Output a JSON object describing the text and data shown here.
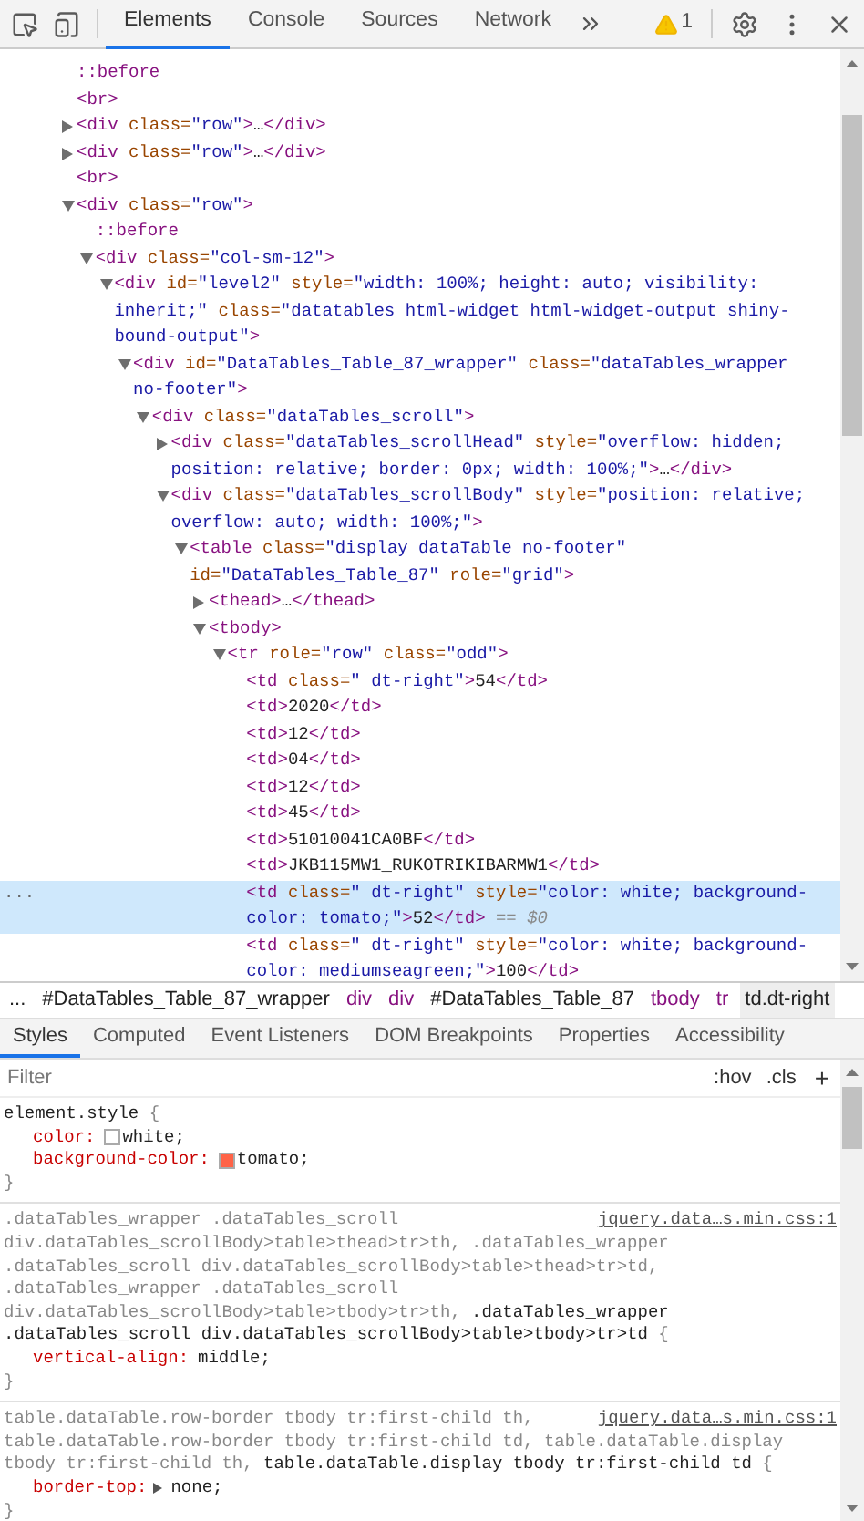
{
  "toolbar": {
    "tabs": [
      {
        "label": "Elements",
        "selected": true
      },
      {
        "label": "Console",
        "selected": false
      },
      {
        "label": "Sources",
        "selected": false
      },
      {
        "label": "Network",
        "selected": false
      }
    ],
    "warnings_count": "1"
  },
  "dom_tree": [
    {
      "kind": "leaf",
      "selected": false,
      "tokens": [
        {
          "kind": "pseudo",
          "text": "::before"
        }
      ]
    },
    {
      "kind": "leaf",
      "selected": false,
      "tokens": [
        {
          "kind": "tag",
          "text": "<br>"
        }
      ]
    },
    {
      "kind": "collapsed",
      "selected": false,
      "tokens": [
        {
          "kind": "tag",
          "text": "<div"
        },
        {
          "kind": "attr",
          "text": " class="
        },
        {
          "kind": "value",
          "text": "\"row\""
        },
        {
          "kind": "tag",
          "text": ">"
        },
        {
          "kind": "text",
          "text": "…"
        },
        {
          "kind": "tag",
          "text": "</div>"
        }
      ]
    },
    {
      "kind": "collapsed",
      "selected": false,
      "tokens": [
        {
          "kind": "tag",
          "text": "<div"
        },
        {
          "kind": "attr",
          "text": " class="
        },
        {
          "kind": "value",
          "text": "\"row\""
        },
        {
          "kind": "tag",
          "text": ">"
        },
        {
          "kind": "text",
          "text": "…"
        },
        {
          "kind": "tag",
          "text": "</div>"
        }
      ]
    },
    {
      "kind": "leaf",
      "selected": false,
      "tokens": [
        {
          "kind": "tag",
          "text": "<br>"
        }
      ]
    },
    {
      "kind": "expanded",
      "selected": false,
      "tokens": [
        {
          "kind": "tag",
          "text": "<div"
        },
        {
          "kind": "attr",
          "text": " class="
        },
        {
          "kind": "value",
          "text": "\"row\""
        },
        {
          "kind": "tag",
          "text": ">"
        }
      ],
      "children": [
        {
          "kind": "leaf",
          "selected": false,
          "tokens": [
            {
              "kind": "pseudo",
              "text": "::before"
            }
          ]
        },
        {
          "kind": "expanded",
          "selected": false,
          "tokens": [
            {
              "kind": "tag",
              "text": "<div"
            },
            {
              "kind": "attr",
              "text": " class="
            },
            {
              "kind": "value",
              "text": "\"col-sm-12\""
            },
            {
              "kind": "tag",
              "text": ">"
            }
          ],
          "children": [
            {
              "kind": "expanded",
              "selected": false,
              "tokens": [
                {
                  "kind": "tag",
                  "text": "<div"
                },
                {
                  "kind": "attr",
                  "text": " id="
                },
                {
                  "kind": "value",
                  "text": "\"level2\""
                },
                {
                  "kind": "attr",
                  "text": " style="
                },
                {
                  "kind": "value",
                  "text": "\"width: 100%; height: auto; visibility: inherit;\""
                },
                {
                  "kind": "attr",
                  "text": " class="
                },
                {
                  "kind": "value",
                  "text": "\"datatables html-widget html-widget-output shiny-bound-output\""
                },
                {
                  "kind": "tag",
                  "text": ">"
                }
              ],
              "children": [
                {
                  "kind": "expanded",
                  "selected": false,
                  "tokens": [
                    {
                      "kind": "tag",
                      "text": "<div"
                    },
                    {
                      "kind": "attr",
                      "text": " id="
                    },
                    {
                      "kind": "value",
                      "text": "\"DataTables_Table_87_wrapper\""
                    },
                    {
                      "kind": "attr",
                      "text": " class="
                    },
                    {
                      "kind": "value",
                      "text": "\"dataTables_wrapper no-footer\""
                    },
                    {
                      "kind": "tag",
                      "text": ">"
                    }
                  ],
                  "children": [
                    {
                      "kind": "expanded",
                      "selected": false,
                      "tokens": [
                        {
                          "kind": "tag",
                          "text": "<div"
                        },
                        {
                          "kind": "attr",
                          "text": " class="
                        },
                        {
                          "kind": "value",
                          "text": "\"dataTables_scroll\""
                        },
                        {
                          "kind": "tag",
                          "text": ">"
                        }
                      ],
                      "children": [
                        {
                          "kind": "collapsed",
                          "selected": false,
                          "tokens": [
                            {
                              "kind": "tag",
                              "text": "<div"
                            },
                            {
                              "kind": "attr",
                              "text": " class="
                            },
                            {
                              "kind": "value",
                              "text": "\"dataTables_scrollHead\""
                            },
                            {
                              "kind": "attr",
                              "text": " style="
                            },
                            {
                              "kind": "value",
                              "text": "\"overflow: hidden; position: relative; border: 0px; width: 100%;\""
                            },
                            {
                              "kind": "tag",
                              "text": ">"
                            },
                            {
                              "kind": "text",
                              "text": "…"
                            },
                            {
                              "kind": "tag",
                              "text": "</div>"
                            }
                          ]
                        },
                        {
                          "kind": "expanded",
                          "selected": false,
                          "tokens": [
                            {
                              "kind": "tag",
                              "text": "<div"
                            },
                            {
                              "kind": "attr",
                              "text": " class="
                            },
                            {
                              "kind": "value",
                              "text": "\"dataTables_scrollBody\""
                            },
                            {
                              "kind": "attr",
                              "text": " style="
                            },
                            {
                              "kind": "value",
                              "text": "\"position: relative; overflow: auto; width: 100%;\""
                            },
                            {
                              "kind": "tag",
                              "text": ">"
                            }
                          ],
                          "children": [
                            {
                              "kind": "expanded",
                              "selected": false,
                              "tokens": [
                                {
                                  "kind": "tag",
                                  "text": "<table"
                                },
                                {
                                  "kind": "attr",
                                  "text": " class="
                                },
                                {
                                  "kind": "value",
                                  "text": "\"display dataTable no-footer\""
                                },
                                {
                                  "kind": "attr",
                                  "text": " id="
                                },
                                {
                                  "kind": "value",
                                  "text": "\"DataTables_Table_87\""
                                },
                                {
                                  "kind": "attr",
                                  "text": " role="
                                },
                                {
                                  "kind": "value",
                                  "text": "\"grid\""
                                },
                                {
                                  "kind": "tag",
                                  "text": ">"
                                }
                              ],
                              "children": [
                                {
                                  "kind": "collapsed",
                                  "selected": false,
                                  "tokens": [
                                    {
                                      "kind": "tag",
                                      "text": "<thead>"
                                    },
                                    {
                                      "kind": "text",
                                      "text": "…"
                                    },
                                    {
                                      "kind": "tag",
                                      "text": "</thead>"
                                    }
                                  ]
                                },
                                {
                                  "kind": "expanded",
                                  "selected": false,
                                  "tokens": [
                                    {
                                      "kind": "tag",
                                      "text": "<tbody>"
                                    }
                                  ],
                                  "children": [
                                    {
                                      "kind": "expanded",
                                      "selected": false,
                                      "tokens": [
                                        {
                                          "kind": "tag",
                                          "text": "<tr"
                                        },
                                        {
                                          "kind": "attr",
                                          "text": " role="
                                        },
                                        {
                                          "kind": "value",
                                          "text": "\"row\""
                                        },
                                        {
                                          "kind": "attr",
                                          "text": " class="
                                        },
                                        {
                                          "kind": "value",
                                          "text": "\"odd\""
                                        },
                                        {
                                          "kind": "tag",
                                          "text": ">"
                                        }
                                      ],
                                      "children": [
                                        {
                                          "kind": "leaf",
                                          "selected": false,
                                          "tokens": [
                                            {
                                              "kind": "tag",
                                              "text": "<td"
                                            },
                                            {
                                              "kind": "attr",
                                              "text": " class="
                                            },
                                            {
                                              "kind": "value",
                                              "text": "\" dt-right\""
                                            },
                                            {
                                              "kind": "tag",
                                              "text": ">"
                                            },
                                            {
                                              "kind": "text",
                                              "text": "54"
                                            },
                                            {
                                              "kind": "tag",
                                              "text": "</td>"
                                            }
                                          ]
                                        },
                                        {
                                          "kind": "leaf",
                                          "selected": false,
                                          "tokens": [
                                            {
                                              "kind": "tag",
                                              "text": "<td>"
                                            },
                                            {
                                              "kind": "text",
                                              "text": "2020"
                                            },
                                            {
                                              "kind": "tag",
                                              "text": "</td>"
                                            }
                                          ]
                                        },
                                        {
                                          "kind": "leaf",
                                          "selected": false,
                                          "tokens": [
                                            {
                                              "kind": "tag",
                                              "text": "<td>"
                                            },
                                            {
                                              "kind": "text",
                                              "text": "12"
                                            },
                                            {
                                              "kind": "tag",
                                              "text": "</td>"
                                            }
                                          ]
                                        },
                                        {
                                          "kind": "leaf",
                                          "selected": false,
                                          "tokens": [
                                            {
                                              "kind": "tag",
                                              "text": "<td>"
                                            },
                                            {
                                              "kind": "text",
                                              "text": "04"
                                            },
                                            {
                                              "kind": "tag",
                                              "text": "</td>"
                                            }
                                          ]
                                        },
                                        {
                                          "kind": "leaf",
                                          "selected": false,
                                          "tokens": [
                                            {
                                              "kind": "tag",
                                              "text": "<td>"
                                            },
                                            {
                                              "kind": "text",
                                              "text": "12"
                                            },
                                            {
                                              "kind": "tag",
                                              "text": "</td>"
                                            }
                                          ]
                                        },
                                        {
                                          "kind": "leaf",
                                          "selected": false,
                                          "tokens": [
                                            {
                                              "kind": "tag",
                                              "text": "<td>"
                                            },
                                            {
                                              "kind": "text",
                                              "text": "45"
                                            },
                                            {
                                              "kind": "tag",
                                              "text": "</td>"
                                            }
                                          ]
                                        },
                                        {
                                          "kind": "leaf",
                                          "selected": false,
                                          "tokens": [
                                            {
                                              "kind": "tag",
                                              "text": "<td>"
                                            },
                                            {
                                              "kind": "text",
                                              "text": "51010041CA0BF"
                                            },
                                            {
                                              "kind": "tag",
                                              "text": "</td>"
                                            }
                                          ]
                                        },
                                        {
                                          "kind": "leaf",
                                          "selected": false,
                                          "tokens": [
                                            {
                                              "kind": "tag",
                                              "text": "<td>"
                                            },
                                            {
                                              "kind": "text",
                                              "text": "JKB115MW1_RUKOTRIKIBARMW1"
                                            },
                                            {
                                              "kind": "tag",
                                              "text": "</td>"
                                            }
                                          ]
                                        },
                                        {
                                          "kind": "leaf",
                                          "selected": true,
                                          "gutter": "...",
                                          "tokens": [
                                            {
                                              "kind": "tag",
                                              "text": "<td"
                                            },
                                            {
                                              "kind": "attr",
                                              "text": " class="
                                            },
                                            {
                                              "kind": "value",
                                              "text": "\" dt-right\""
                                            },
                                            {
                                              "kind": "attr",
                                              "text": " style="
                                            },
                                            {
                                              "kind": "value",
                                              "text": "\"color: white; background-color: tomato;\""
                                            },
                                            {
                                              "kind": "tag",
                                              "text": ">"
                                            },
                                            {
                                              "kind": "text",
                                              "text": "52"
                                            },
                                            {
                                              "kind": "tag",
                                              "text": "</td>"
                                            },
                                            {
                                              "kind": "hint",
                                              "text": " == $0"
                                            }
                                          ]
                                        },
                                        {
                                          "kind": "leaf",
                                          "selected": false,
                                          "tokens": [
                                            {
                                              "kind": "tag",
                                              "text": "<td"
                                            },
                                            {
                                              "kind": "attr",
                                              "text": " class="
                                            },
                                            {
                                              "kind": "value",
                                              "text": "\" dt-right\""
                                            },
                                            {
                                              "kind": "attr",
                                              "text": " style="
                                            },
                                            {
                                              "kind": "value",
                                              "text": "\"color: white; background-color: mediumseagreen;\""
                                            },
                                            {
                                              "kind": "tag",
                                              "text": ">"
                                            },
                                            {
                                              "kind": "text",
                                              "text": "100"
                                            },
                                            {
                                              "kind": "tag",
                                              "text": "</td>"
                                            }
                                          ]
                                        }
                                      ]
                                    }
                                  ]
                                }
                              ]
                            }
                          ]
                        }
                      ]
                    }
                  ]
                }
              ]
            }
          ]
        }
      ]
    }
  ],
  "breadcrumbs": [
    {
      "label": "...",
      "kind": "more",
      "selected": false
    },
    {
      "label": "#DataTables_Table_87_wrapper",
      "kind": "id",
      "selected": false
    },
    {
      "label": "div",
      "kind": "tag",
      "selected": false
    },
    {
      "label": "div",
      "kind": "tag",
      "selected": false
    },
    {
      "label": "#DataTables_Table_87",
      "kind": "id",
      "selected": false
    },
    {
      "label": "tbody",
      "kind": "tag",
      "selected": false
    },
    {
      "label": "tr",
      "kind": "tag",
      "selected": false
    },
    {
      "label": "td.dt-right",
      "kind": "id",
      "selected": true
    }
  ],
  "sidebar_tabs": [
    {
      "label": "Styles",
      "selected": true
    },
    {
      "label": "Computed",
      "selected": false
    },
    {
      "label": "Event Listeners",
      "selected": false
    },
    {
      "label": "DOM Breakpoints",
      "selected": false
    },
    {
      "label": "Properties",
      "selected": false
    },
    {
      "label": "Accessibility",
      "selected": false
    }
  ],
  "filter": {
    "placeholder": "Filter",
    "hov": ":hov",
    "cls": ".cls",
    "add": "+"
  },
  "rules": [
    {
      "selector_lines": [
        [
          {
            "text": "element.style",
            "matched": true
          },
          {
            "text": " {",
            "matched": false
          }
        ]
      ],
      "close": "}",
      "properties": [
        {
          "name": "color:",
          "value": "white;",
          "color": "#ffffff",
          "expandable": false
        },
        {
          "name": "background-color:",
          "value": "tomato;",
          "color": "#ff6347",
          "expandable": false
        }
      ]
    },
    {
      "source": "jquery.data…s.min.css:1",
      "selector_lines": [
        [
          {
            "text": ".dataTables_wrapper .dataTables_scroll",
            "matched": false
          }
        ],
        [
          {
            "text": "div.dataTables_scrollBody>table>thead>tr>th, .dataTables_wrapper",
            "matched": false
          }
        ],
        [
          {
            "text": ".dataTables_scroll div.dataTables_scrollBody>table>thead>tr>td,",
            "matched": false
          }
        ],
        [
          {
            "text": ".dataTables_wrapper .dataTables_scroll",
            "matched": false
          }
        ],
        [
          {
            "text": "div.dataTables_scrollBody>table>tbody>tr>th,",
            "matched": false
          },
          {
            "text": " .dataTables_wrapper",
            "matched": true
          }
        ],
        [
          {
            "text": ".dataTables_scroll div.dataTables_scrollBody>table>tbody>tr>td",
            "matched": true
          },
          {
            "text": " {",
            "matched": false
          }
        ]
      ],
      "close": "}",
      "properties": [
        {
          "name": "vertical-align:",
          "value": "middle;",
          "expandable": false
        }
      ]
    },
    {
      "source": "jquery.data…s.min.css:1",
      "selector_lines": [
        [
          {
            "text": "table.dataTable.row-border tbody tr:first-child th,",
            "matched": false
          }
        ],
        [
          {
            "text": "table.dataTable.row-border tbody tr:first-child td, table.dataTable.display",
            "matched": false
          }
        ],
        [
          {
            "text": "tbody tr:first-child th,",
            "matched": false
          },
          {
            "text": " table.dataTable.display tbody tr:first-child td",
            "matched": true
          },
          {
            "text": " {",
            "matched": false
          }
        ]
      ],
      "close": "}",
      "properties": [
        {
          "name": "border-top:",
          "value": "none;",
          "expandable": true
        }
      ]
    }
  ]
}
